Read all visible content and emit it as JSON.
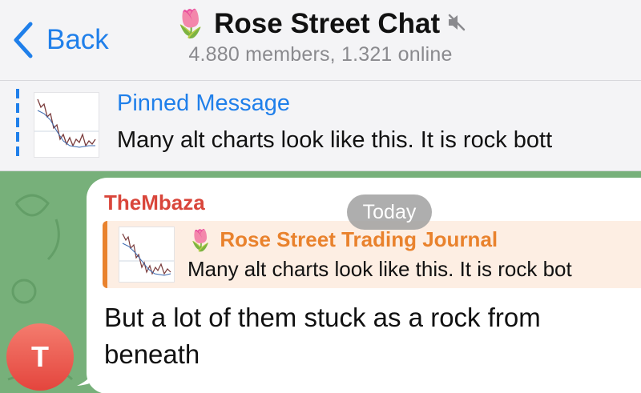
{
  "header": {
    "back_label": "Back",
    "title_emoji": "🌷",
    "title": "Rose Street Chat",
    "subtitle": "4.880 members, 1.321 online",
    "muted_icon": "speaker-muted-icon"
  },
  "pinned": {
    "title": "Pinned Message",
    "text": "Many alt charts look like this. It is rock bott"
  },
  "date_separator": "Today",
  "message": {
    "sender": "TheMbaza",
    "avatar_initial": "T",
    "reply": {
      "emoji": "🌷",
      "title": "Rose Street Trading Journal",
      "text": "Many alt charts look like this. It is rock bot"
    },
    "text": "But a lot of them stuck as a rock from beneath"
  },
  "colors": {
    "accent": "#1f7fea",
    "sender": "#d9463b",
    "reply_accent": "#e9822d",
    "chat_bg": "#77b07a"
  }
}
